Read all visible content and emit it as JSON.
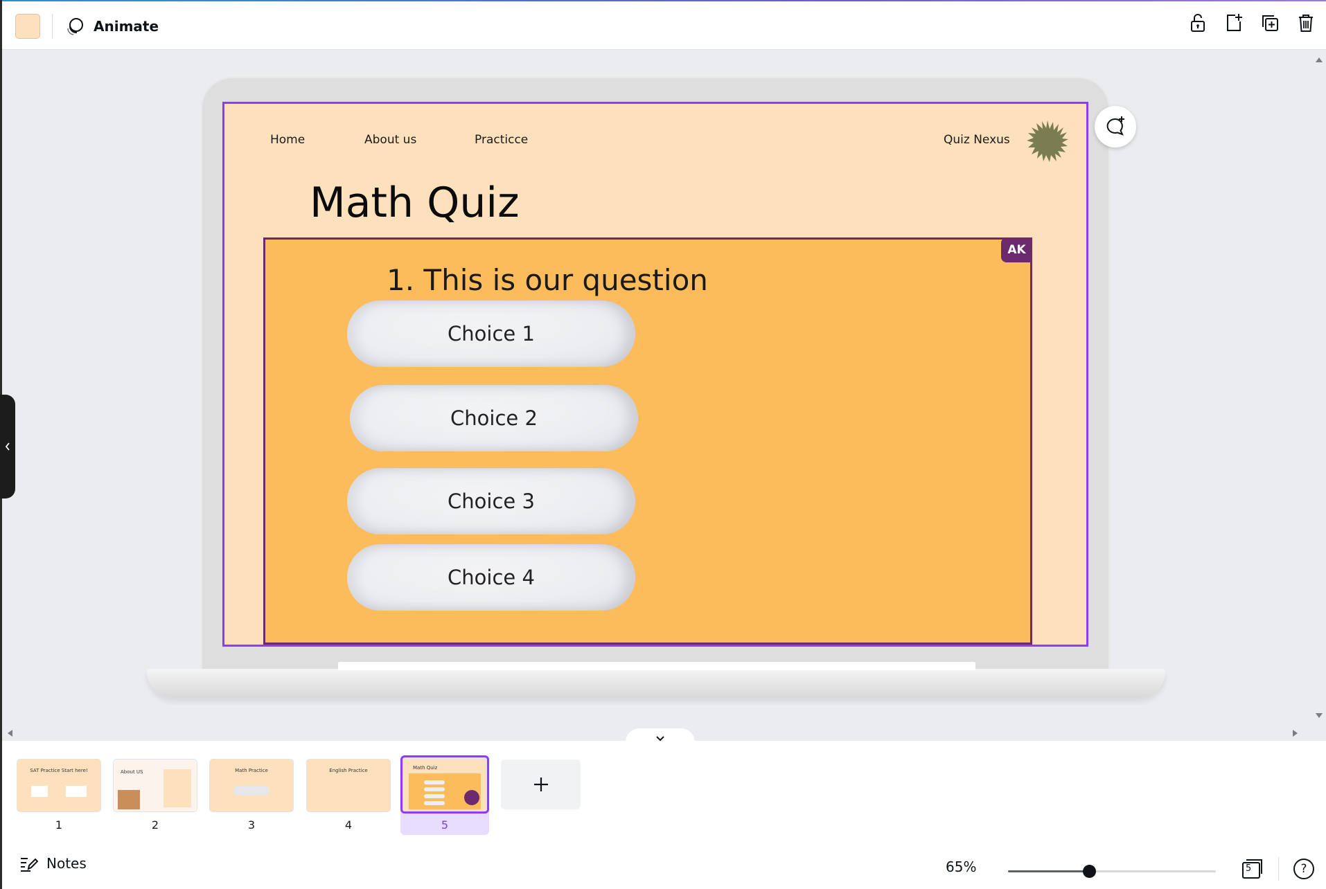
{
  "toolbar": {
    "swatch_color": "#fde1bd",
    "animate_label": "Animate",
    "icons": [
      "unlock-icon",
      "add-page-icon",
      "duplicate-icon",
      "trash-icon"
    ]
  },
  "design": {
    "nav": [
      "Home",
      "About us",
      "Practicce"
    ],
    "brand": "Quiz Nexus",
    "title": "Math Quiz",
    "question": "1. This is our question",
    "choices": [
      "Choice 1",
      "Choice 2",
      "Choice 3",
      "Choice 4"
    ],
    "collaborator_badge": "AK",
    "page_bg": "#fde1bd",
    "quiz_bg": "#fdbc5b",
    "quiz_border": "#6b2a6e",
    "selection_color": "#8b3dff"
  },
  "pages": {
    "thumbnails": [
      {
        "number": "1",
        "title": "SAT Practice Start here!"
      },
      {
        "number": "2",
        "title": "About US"
      },
      {
        "number": "3",
        "title": "Math Practice"
      },
      {
        "number": "4",
        "title": "English Practice"
      },
      {
        "number": "5",
        "title": "Math Quiz"
      }
    ],
    "selected": "5"
  },
  "footer": {
    "notes_label": "Notes",
    "zoom": "65%",
    "zoom_level": 0.39,
    "page_count": "5",
    "help": "?"
  }
}
